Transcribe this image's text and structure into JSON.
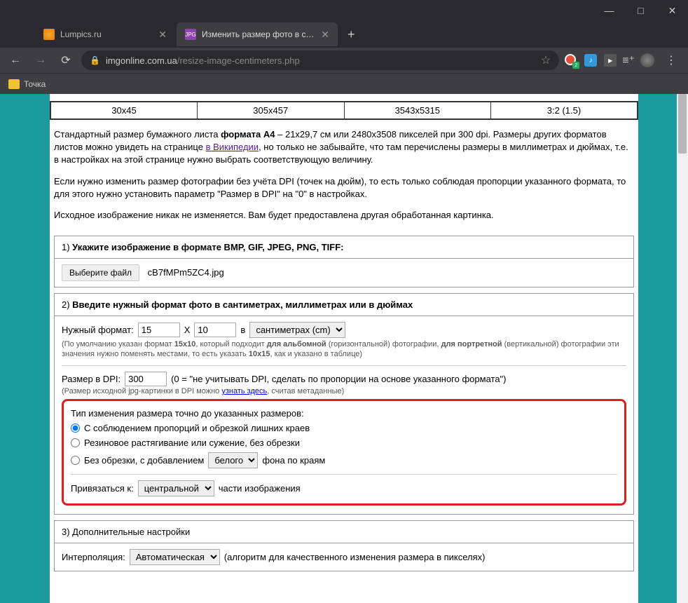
{
  "window": {
    "tabs": [
      {
        "title": "Lumpics.ru",
        "active": false
      },
      {
        "title": "Изменить размер фото в санти",
        "active": true
      }
    ],
    "new_tab": "+"
  },
  "toolbar": {
    "url_host": "imgonline.com.ua",
    "url_path": "/resize-image-centimeters.php",
    "star": "☆"
  },
  "bookmarks": {
    "item1": "Точка"
  },
  "table": {
    "row1": [
      "30x45",
      "305x457",
      "3543x5315",
      "3:2 (1.5)"
    ]
  },
  "text": {
    "para1_a": "Стандартный размер бумажного листа ",
    "para1_b": "формата A4",
    "para1_c": " – 21x29,7 см или 2480x3508 пикселей при 300 dpi. Размеры других форматов листов можно увидеть на странице ",
    "para1_link": "в Википедии",
    "para1_d": ", но только не забывайте, что там перечислены размеры в миллиметрах и дюймах, т.е. в настройках на этой странице нужно выбрать соответствующую величину.",
    "para2": "Если нужно изменить размер фотографии без учёта DPI (точек на дюйм), то есть только соблюдая пропорции указанного формата, то для этого нужно установить параметр \"Размер в DPI\" на \"0\" в настройках.",
    "para3": "Исходное изображение никак не изменяется. Вам будет предоставлена другая обработанная картинка."
  },
  "section1": {
    "num": "1) ",
    "title": "Укажите изображение в формате BMP, GIF, JPEG, PNG, TIFF:",
    "file_btn": "Выберите файл",
    "file_name": "cB7fMPm5ZC4.jpg"
  },
  "section2": {
    "num": "2) ",
    "title": "Введите нужный формат фото в сантиметрах, миллиметрах или в дюймах",
    "format_label": "Нужный формат:",
    "width": "15",
    "x": "X",
    "height": "10",
    "in": "в",
    "unit": "сантиметрах (cm)",
    "hint1_a": "(По умолчанию указан формат ",
    "hint1_b": "15x10",
    "hint1_c": ", который подходит ",
    "hint1_d": "для альбомной",
    "hint1_e": " (горизонтальной) фотографии, ",
    "hint1_f": "для портретной",
    "hint1_g": " (вертикальной) фотографии эти значения нужно поменять местами, то есть указать ",
    "hint1_h": "10x15",
    "hint1_i": ", как и указано в таблице)",
    "dpi_label": "Размер в DPI:",
    "dpi_value": "300",
    "dpi_hint": "(0 = \"не учитывать DPI, сделать по пропорции на основе указанного формата\")",
    "dpi_hint2_a": "(Размер исходной jpg-картинки в DPI можно ",
    "dpi_hint2_link": "узнать здесь",
    "dpi_hint2_b": ", считав метаданные)",
    "resize_label": "Тип изменения размера точно до указанных размеров:",
    "radio1": "С соблюдением пропорций и обрезкой лишних краев",
    "radio2": "Резиновое растягивание или сужение, без обрезки",
    "radio3_a": "Без обрезки, с добавлением",
    "radio3_select": "белого",
    "radio3_b": "фона по краям",
    "anchor_label": "Привязаться к:",
    "anchor_select": "центральной",
    "anchor_b": "части изображения"
  },
  "section3": {
    "num": "3) ",
    "title": "Дополнительные настройки",
    "interp_label": "Интерполяция:",
    "interp_select": "Автоматическая",
    "interp_hint": "(алгоритм для качественного изменения размера в пикселях)"
  }
}
